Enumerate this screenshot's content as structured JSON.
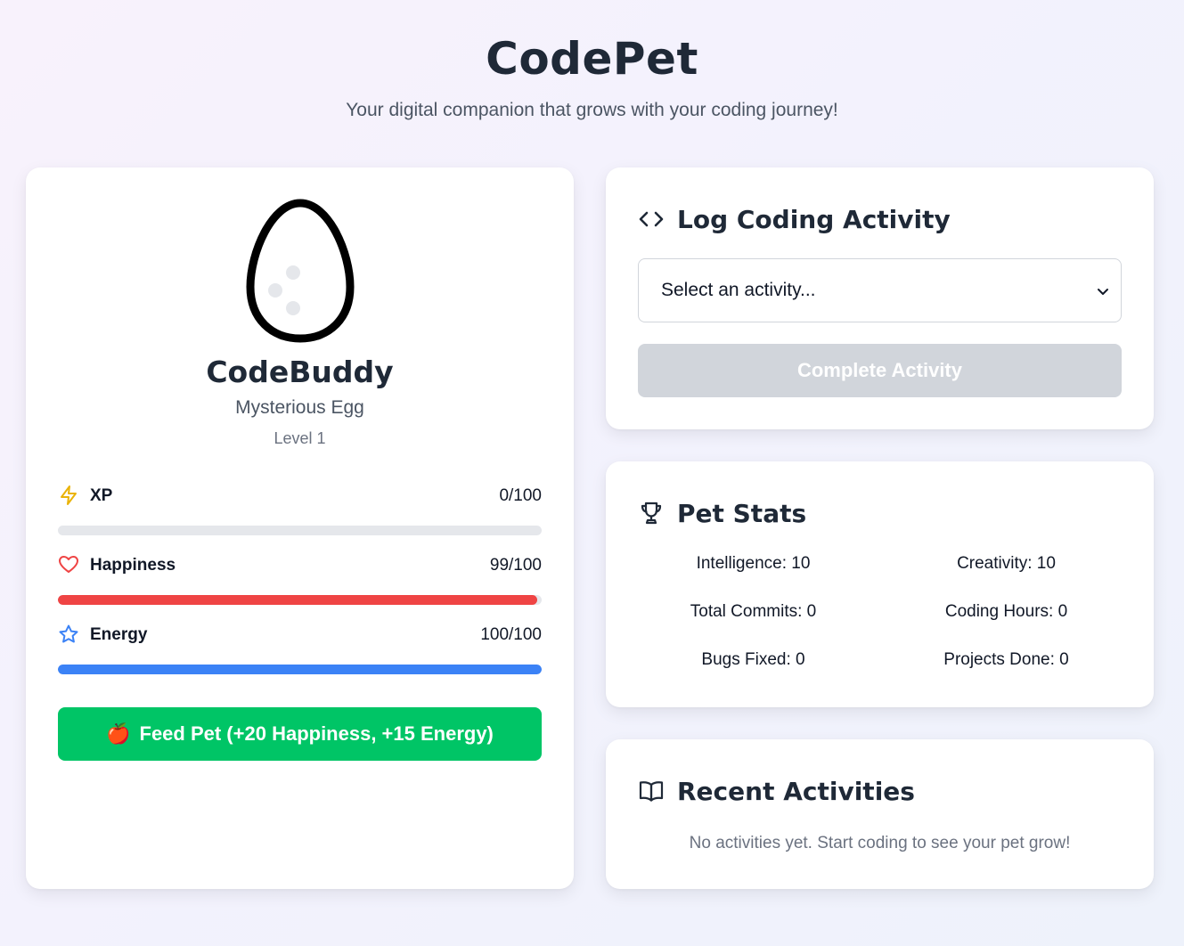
{
  "header": {
    "title": "CodePet",
    "subtitle": "Your digital companion that grows with your coding journey!"
  },
  "pet": {
    "name": "CodeBuddy",
    "stage": "Mysterious Egg",
    "level": "Level 1",
    "stats": [
      {
        "label": "XP",
        "value": "0/100",
        "percent": 0,
        "color": "#9ca3af",
        "icon": "lightning-icon"
      },
      {
        "label": "Happiness",
        "value": "99/100",
        "percent": 99,
        "color": "#ef4444",
        "icon": "heart-icon"
      },
      {
        "label": "Energy",
        "value": "100/100",
        "percent": 100,
        "color": "#3b82f6",
        "icon": "star-icon"
      }
    ],
    "feed_button": {
      "emoji": "🍎",
      "label": "Feed Pet (+20 Happiness, +15 Energy)"
    }
  },
  "activity": {
    "title": "Log Coding Activity",
    "select_placeholder": "Select an activity...",
    "complete_label": "Complete Activity"
  },
  "pet_stats": {
    "title": "Pet Stats",
    "items": [
      "Intelligence: 10",
      "Creativity: 10",
      "Total Commits: 0",
      "Coding Hours: 0",
      "Bugs Fixed: 0",
      "Projects Done: 0"
    ]
  },
  "recent": {
    "title": "Recent Activities",
    "empty": "No activities yet. Start coding to see your pet grow!"
  },
  "colors": {
    "feed_button": "#00c566",
    "complete_disabled": "#d1d5db",
    "happiness": "#ef4444",
    "energy": "#3b82f6",
    "xp_icon": "#eab308"
  }
}
